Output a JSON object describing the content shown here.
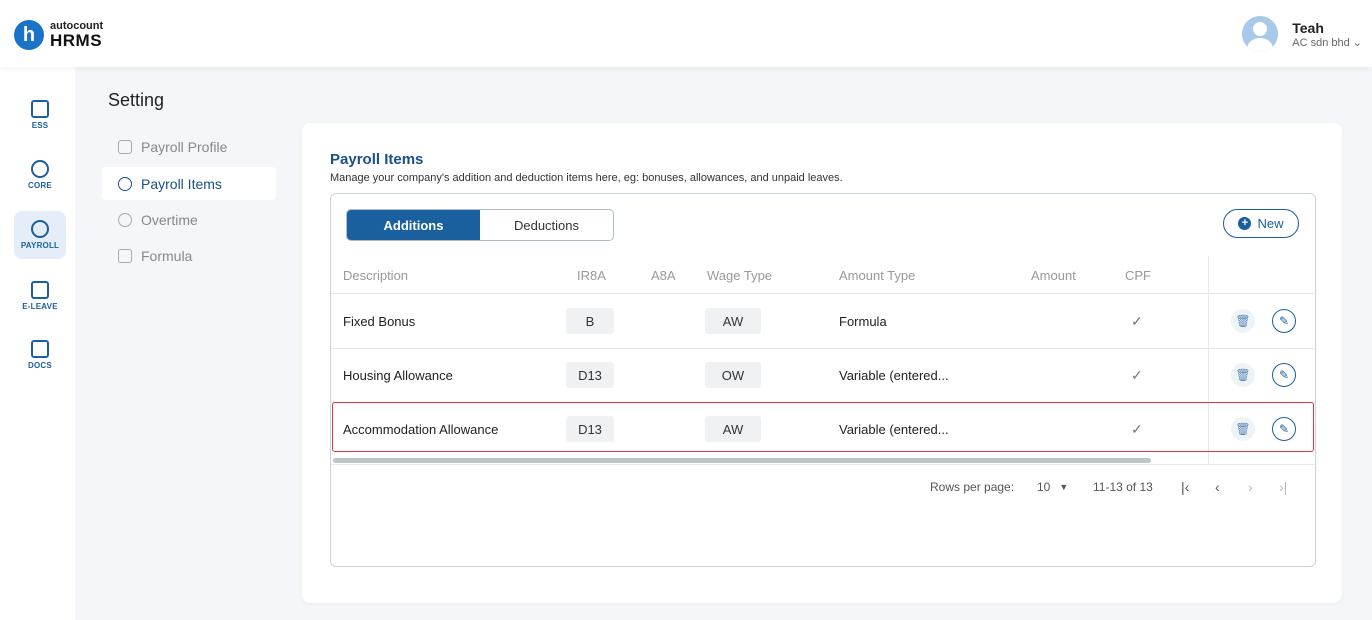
{
  "header": {
    "logo_small": "autocount",
    "logo_big": "HRMS",
    "logo_letter": "h",
    "user_name": "Teah",
    "user_company": "AC sdn bhd ⌄"
  },
  "rail": [
    {
      "label": "ESS",
      "icon": "ess-icon",
      "active": false
    },
    {
      "label": "CORE",
      "icon": "core-icon",
      "active": false
    },
    {
      "label": "PAYROLL",
      "icon": "payroll-icon",
      "active": true
    },
    {
      "label": "E-LEAVE",
      "icon": "calendar-icon",
      "active": false
    },
    {
      "label": "DOCS",
      "icon": "docs-icon",
      "active": false
    }
  ],
  "settings": {
    "title": "Setting",
    "menu": [
      {
        "label": "Payroll Profile",
        "active": false
      },
      {
        "label": "Payroll Items",
        "active": true
      },
      {
        "label": "Overtime",
        "active": false
      },
      {
        "label": "Formula",
        "active": false
      }
    ]
  },
  "card": {
    "title": "Payroll Items",
    "subtitle": "Manage your company's addition and deduction items here, eg: bonuses, allowances, and unpaid leaves.",
    "tabs": [
      "Additions",
      "Deductions"
    ],
    "new_label": "New"
  },
  "table": {
    "columns": [
      "Description",
      "IR8A",
      "A8A",
      "Wage Type",
      "Amount Type",
      "Amount",
      "CPF"
    ],
    "rows": [
      {
        "description": "Fixed Bonus",
        "ir8a": "B",
        "wage_type": "AW",
        "amount_type": "Formula",
        "cpf": "✓"
      },
      {
        "description": "Housing Allowance",
        "ir8a": "D13",
        "wage_type": "OW",
        "amount_type": "Variable (entered...",
        "cpf": "✓"
      },
      {
        "description": "Accommodation Allowance",
        "ir8a": "D13",
        "wage_type": "AW",
        "amount_type": "Variable (entered...",
        "cpf": "✓"
      }
    ]
  },
  "pagination": {
    "rows_per_page_label": "Rows per page:",
    "rows_per_page_value": "10",
    "range": "11-13 of 13"
  }
}
